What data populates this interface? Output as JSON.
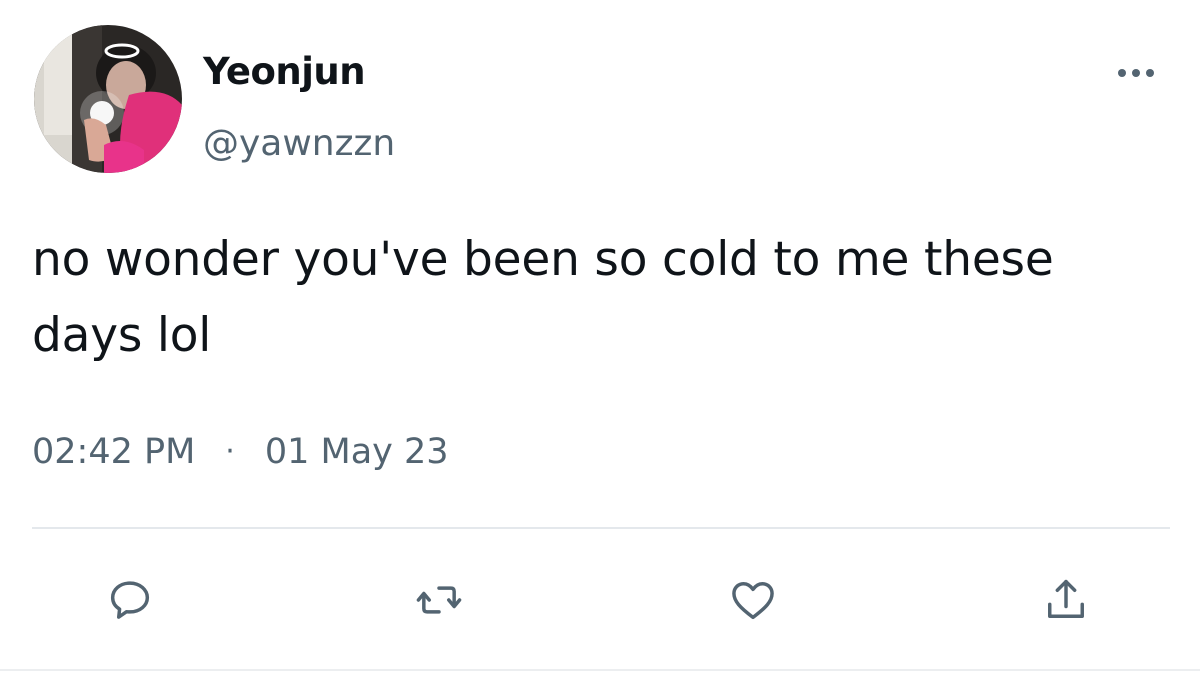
{
  "tweet": {
    "author": {
      "display_name": "Yeonjun",
      "handle": "@yawnzzn"
    },
    "text": "no wonder you've been so cold to me these days lol",
    "time": "02:42 PM",
    "separator": "·",
    "date": "01 May 23"
  },
  "actions": [
    {
      "icon": "reply-icon"
    },
    {
      "icon": "retweet-icon"
    },
    {
      "icon": "like-icon"
    },
    {
      "icon": "share-icon"
    }
  ],
  "colors": {
    "text_primary": "#0f1419",
    "text_secondary": "#536471",
    "icon": "#536471",
    "divider": "#e4e8ec"
  }
}
